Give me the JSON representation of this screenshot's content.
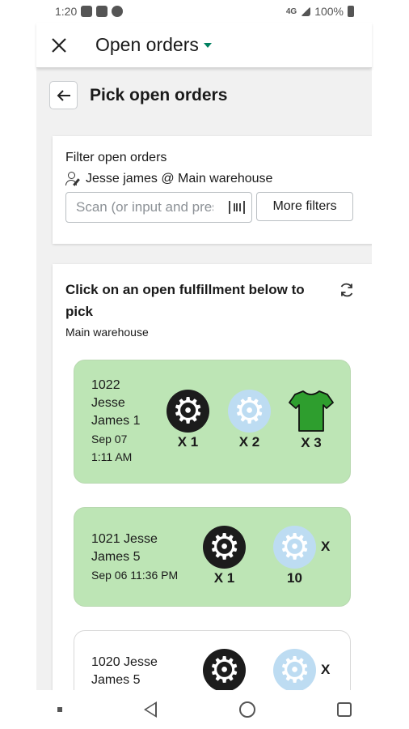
{
  "status_bar": {
    "time": "1:20",
    "network": "4G",
    "battery": "100%"
  },
  "app_bar": {
    "title": "Open orders"
  },
  "page": {
    "title": "Pick open orders"
  },
  "filter": {
    "title": "Filter open orders",
    "user": "Jesse james @ Main warehouse",
    "scan_placeholder": "Scan (or input and press enter)",
    "more_filters": "More filters"
  },
  "list": {
    "title": "Click on an open fulfillment below to pick",
    "location": "Main warehouse"
  },
  "orders": [
    {
      "lines": [
        "1022",
        "Jesse",
        "James 1"
      ],
      "date_lines": [
        "Sep 07",
        "1:11 AM"
      ],
      "items": [
        {
          "icon": "gear-dark",
          "qty": "X 1"
        },
        {
          "icon": "gear-light",
          "qty": "X 2"
        },
        {
          "icon": "shirt-green",
          "qty": "X 3"
        }
      ]
    },
    {
      "lines": [
        "1021 Jesse",
        "James 5"
      ],
      "date_lines": [
        "Sep 06 11:36 PM"
      ],
      "items": [
        {
          "icon": "gear-dark",
          "qty": "X 1"
        },
        {
          "icon": "gear-light",
          "qty_prefix": "X",
          "qty": "10"
        }
      ]
    },
    {
      "lines": [
        "1020 Jesse",
        "James 5"
      ],
      "items": [
        {
          "icon": "gear-dark"
        },
        {
          "icon": "gear-light",
          "qty_prefix": "X"
        }
      ]
    }
  ],
  "colors": {
    "order_green": "#bde5b5",
    "accent": "#008060",
    "shirt": "#2e9e2e"
  }
}
